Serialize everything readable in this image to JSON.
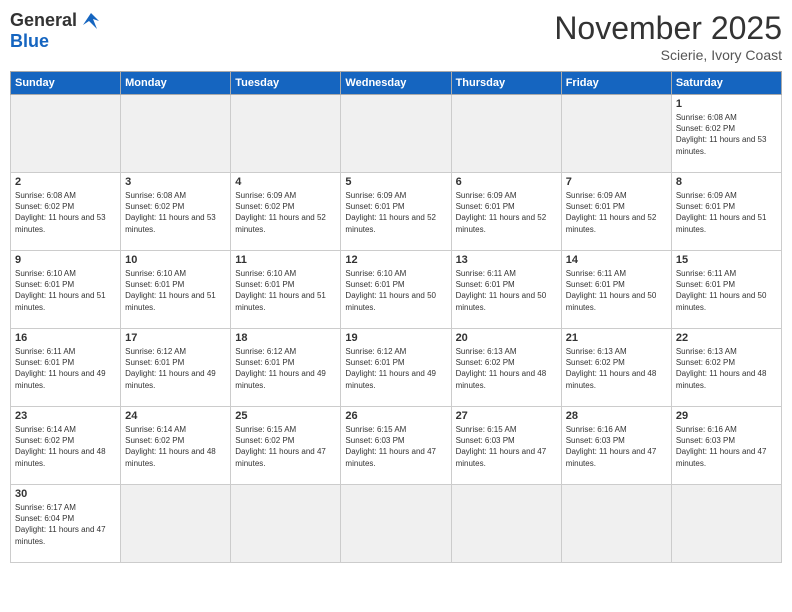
{
  "logo": {
    "general": "General",
    "blue": "Blue"
  },
  "title": "November 2025",
  "subtitle": "Scierie, Ivory Coast",
  "headers": [
    "Sunday",
    "Monday",
    "Tuesday",
    "Wednesday",
    "Thursday",
    "Friday",
    "Saturday"
  ],
  "weeks": [
    [
      {
        "day": "",
        "empty": true
      },
      {
        "day": "",
        "empty": true
      },
      {
        "day": "",
        "empty": true
      },
      {
        "day": "",
        "empty": true
      },
      {
        "day": "",
        "empty": true
      },
      {
        "day": "",
        "empty": true
      },
      {
        "day": "1",
        "sunrise": "6:08 AM",
        "sunset": "6:02 PM",
        "daylight": "11 hours and 53 minutes."
      }
    ],
    [
      {
        "day": "2",
        "sunrise": "6:08 AM",
        "sunset": "6:02 PM",
        "daylight": "11 hours and 53 minutes."
      },
      {
        "day": "3",
        "sunrise": "6:08 AM",
        "sunset": "6:02 PM",
        "daylight": "11 hours and 53 minutes."
      },
      {
        "day": "4",
        "sunrise": "6:09 AM",
        "sunset": "6:02 PM",
        "daylight": "11 hours and 52 minutes."
      },
      {
        "day": "5",
        "sunrise": "6:09 AM",
        "sunset": "6:01 PM",
        "daylight": "11 hours and 52 minutes."
      },
      {
        "day": "6",
        "sunrise": "6:09 AM",
        "sunset": "6:01 PM",
        "daylight": "11 hours and 52 minutes."
      },
      {
        "day": "7",
        "sunrise": "6:09 AM",
        "sunset": "6:01 PM",
        "daylight": "11 hours and 52 minutes."
      },
      {
        "day": "8",
        "sunrise": "6:09 AM",
        "sunset": "6:01 PM",
        "daylight": "11 hours and 51 minutes."
      }
    ],
    [
      {
        "day": "9",
        "sunrise": "6:10 AM",
        "sunset": "6:01 PM",
        "daylight": "11 hours and 51 minutes."
      },
      {
        "day": "10",
        "sunrise": "6:10 AM",
        "sunset": "6:01 PM",
        "daylight": "11 hours and 51 minutes."
      },
      {
        "day": "11",
        "sunrise": "6:10 AM",
        "sunset": "6:01 PM",
        "daylight": "11 hours and 51 minutes."
      },
      {
        "day": "12",
        "sunrise": "6:10 AM",
        "sunset": "6:01 PM",
        "daylight": "11 hours and 50 minutes."
      },
      {
        "day": "13",
        "sunrise": "6:11 AM",
        "sunset": "6:01 PM",
        "daylight": "11 hours and 50 minutes."
      },
      {
        "day": "14",
        "sunrise": "6:11 AM",
        "sunset": "6:01 PM",
        "daylight": "11 hours and 50 minutes."
      },
      {
        "day": "15",
        "sunrise": "6:11 AM",
        "sunset": "6:01 PM",
        "daylight": "11 hours and 50 minutes."
      }
    ],
    [
      {
        "day": "16",
        "sunrise": "6:11 AM",
        "sunset": "6:01 PM",
        "daylight": "11 hours and 49 minutes."
      },
      {
        "day": "17",
        "sunrise": "6:12 AM",
        "sunset": "6:01 PM",
        "daylight": "11 hours and 49 minutes."
      },
      {
        "day": "18",
        "sunrise": "6:12 AM",
        "sunset": "6:01 PM",
        "daylight": "11 hours and 49 minutes."
      },
      {
        "day": "19",
        "sunrise": "6:12 AM",
        "sunset": "6:01 PM",
        "daylight": "11 hours and 49 minutes."
      },
      {
        "day": "20",
        "sunrise": "6:13 AM",
        "sunset": "6:02 PM",
        "daylight": "11 hours and 48 minutes."
      },
      {
        "day": "21",
        "sunrise": "6:13 AM",
        "sunset": "6:02 PM",
        "daylight": "11 hours and 48 minutes."
      },
      {
        "day": "22",
        "sunrise": "6:13 AM",
        "sunset": "6:02 PM",
        "daylight": "11 hours and 48 minutes."
      }
    ],
    [
      {
        "day": "23",
        "sunrise": "6:14 AM",
        "sunset": "6:02 PM",
        "daylight": "11 hours and 48 minutes."
      },
      {
        "day": "24",
        "sunrise": "6:14 AM",
        "sunset": "6:02 PM",
        "daylight": "11 hours and 48 minutes."
      },
      {
        "day": "25",
        "sunrise": "6:15 AM",
        "sunset": "6:02 PM",
        "daylight": "11 hours and 47 minutes."
      },
      {
        "day": "26",
        "sunrise": "6:15 AM",
        "sunset": "6:03 PM",
        "daylight": "11 hours and 47 minutes."
      },
      {
        "day": "27",
        "sunrise": "6:15 AM",
        "sunset": "6:03 PM",
        "daylight": "11 hours and 47 minutes."
      },
      {
        "day": "28",
        "sunrise": "6:16 AM",
        "sunset": "6:03 PM",
        "daylight": "11 hours and 47 minutes."
      },
      {
        "day": "29",
        "sunrise": "6:16 AM",
        "sunset": "6:03 PM",
        "daylight": "11 hours and 47 minutes."
      }
    ],
    [
      {
        "day": "30",
        "sunrise": "6:17 AM",
        "sunset": "6:04 PM",
        "daylight": "11 hours and 47 minutes."
      },
      {
        "day": "",
        "empty": true
      },
      {
        "day": "",
        "empty": true
      },
      {
        "day": "",
        "empty": true
      },
      {
        "day": "",
        "empty": true
      },
      {
        "day": "",
        "empty": true
      },
      {
        "day": "",
        "empty": true
      }
    ]
  ]
}
